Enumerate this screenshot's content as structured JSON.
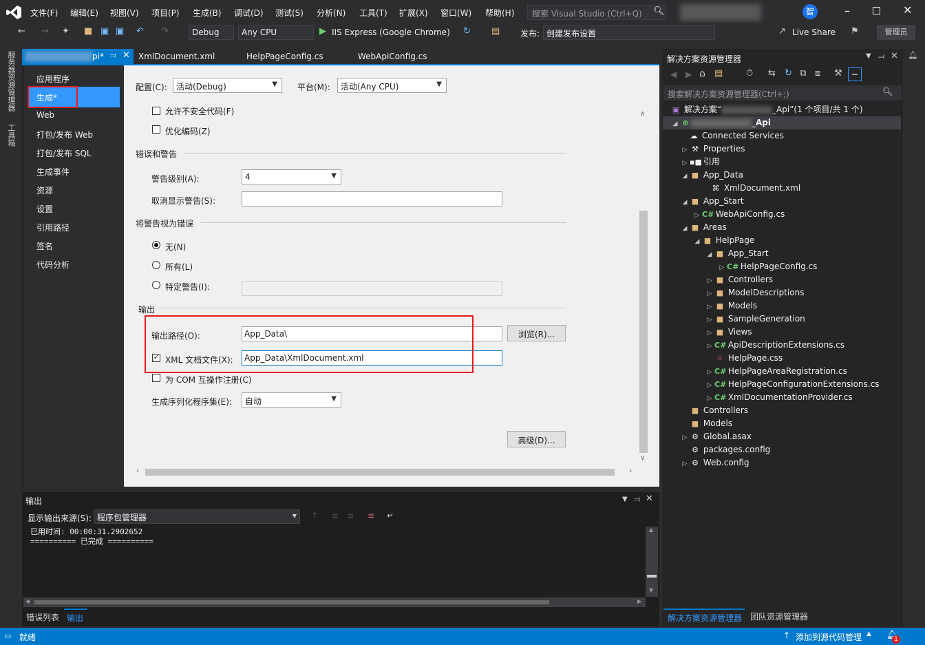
{
  "menubar": {
    "items": [
      "文件(F)",
      "编辑(E)",
      "视图(V)",
      "项目(P)",
      "生成(B)",
      "调试(D)",
      "测试(S)",
      "分析(N)",
      "工具(T)",
      "扩展(X)",
      "窗口(W)",
      "帮助(H)"
    ],
    "search_placeholder": "搜索 Visual Studio (Ctrl+Q)",
    "user_initial": "智"
  },
  "toolbar": {
    "config": "Debug",
    "platform": "Any CPU",
    "run": "IIS Express (Google Chrome)",
    "publish_label": "发布:",
    "publish_value": "创建发布设置",
    "live_share": "Live Share",
    "admin": "管理员"
  },
  "left_tabs": [
    "服务器资源管理器",
    "工具箱"
  ],
  "doc_tabs": {
    "active_suffix": "pi*",
    "tabs": [
      "XmlDocument.xml",
      "HelpPageConfig.cs",
      "WebApiConfig.cs"
    ]
  },
  "propnav": {
    "items": [
      "应用程序",
      "生成*",
      "Web",
      "打包/发布 Web",
      "打包/发布 SQL",
      "生成事件",
      "资源",
      "设置",
      "引用路径",
      "签名",
      "代码分析"
    ]
  },
  "build": {
    "config_label": "配置(C):",
    "config_value": "活动(Debug)",
    "platform_label": "平台(M):",
    "platform_value": "活动(Any CPU)",
    "unsafe_label": "允许不安全代码(F)",
    "optimize_label": "优化编码(Z)",
    "errors_section": "错误和警告",
    "warning_level_label": "警告级别(A):",
    "warning_level_value": "4",
    "suppress_label": "取消显示警告(S):",
    "suppress_value": "",
    "treat_section": "将警告视为错误",
    "radio_none": "无(N)",
    "radio_all": "所有(L)",
    "radio_specific": "特定警告(I):",
    "output_section": "输出",
    "output_path_label": "输出路径(O):",
    "output_path_value": "App_Data\\",
    "browse": "浏览(R)...",
    "xml_doc_label": "XML 文档文件(X):",
    "xml_doc_value": "App_Data\\XmlDocument.xml",
    "com_label": "为 COM 互操作注册(C)",
    "serialization_label": "生成序列化程序集(E):",
    "serialization_value": "自动",
    "advanced": "高级(D)..."
  },
  "solution": {
    "title": "解决方案资源管理器",
    "search_placeholder": "搜索解决方案资源管理器(Ctrl+;)",
    "root": "解决方案“",
    "root_suffix": "_Api”(1 个项目/共 1 个)",
    "project": "_Api",
    "items": [
      "Connected Services",
      "Properties",
      "引用",
      "App_Data",
      "XmlDocument.xml",
      "App_Start",
      "WebApiConfig.cs",
      "Areas",
      "HelpPage",
      "App_Start",
      "HelpPageConfig.cs",
      "Controllers",
      "ModelDescriptions",
      "Models",
      "SampleGeneration",
      "Views",
      "ApiDescriptionExtensions.cs",
      "HelpPage.css",
      "HelpPageAreaRegistration.cs",
      "HelpPageConfigurationExtensions.cs",
      "XmlDocumentationProvider.cs",
      "Controllers",
      "Models",
      "Global.asax",
      "packages.config",
      "Web.config"
    ],
    "bottom_tabs": [
      "解决方案资源管理器",
      "团队资源管理器"
    ]
  },
  "output": {
    "title": "输出",
    "source_label": "显示输出来源(S):",
    "source_value": "程序包管理器",
    "line1": "已用时间: 00:00:31.2902652",
    "line2": "========== 已完成 ==========",
    "tabs": [
      "错误列表",
      "输出"
    ]
  },
  "status": {
    "ready": "就绪",
    "source_control": "添加到源代码管理",
    "notif_count": "1"
  },
  "colors": {
    "accent": "#007acc",
    "highlight": "#e51b1b"
  }
}
